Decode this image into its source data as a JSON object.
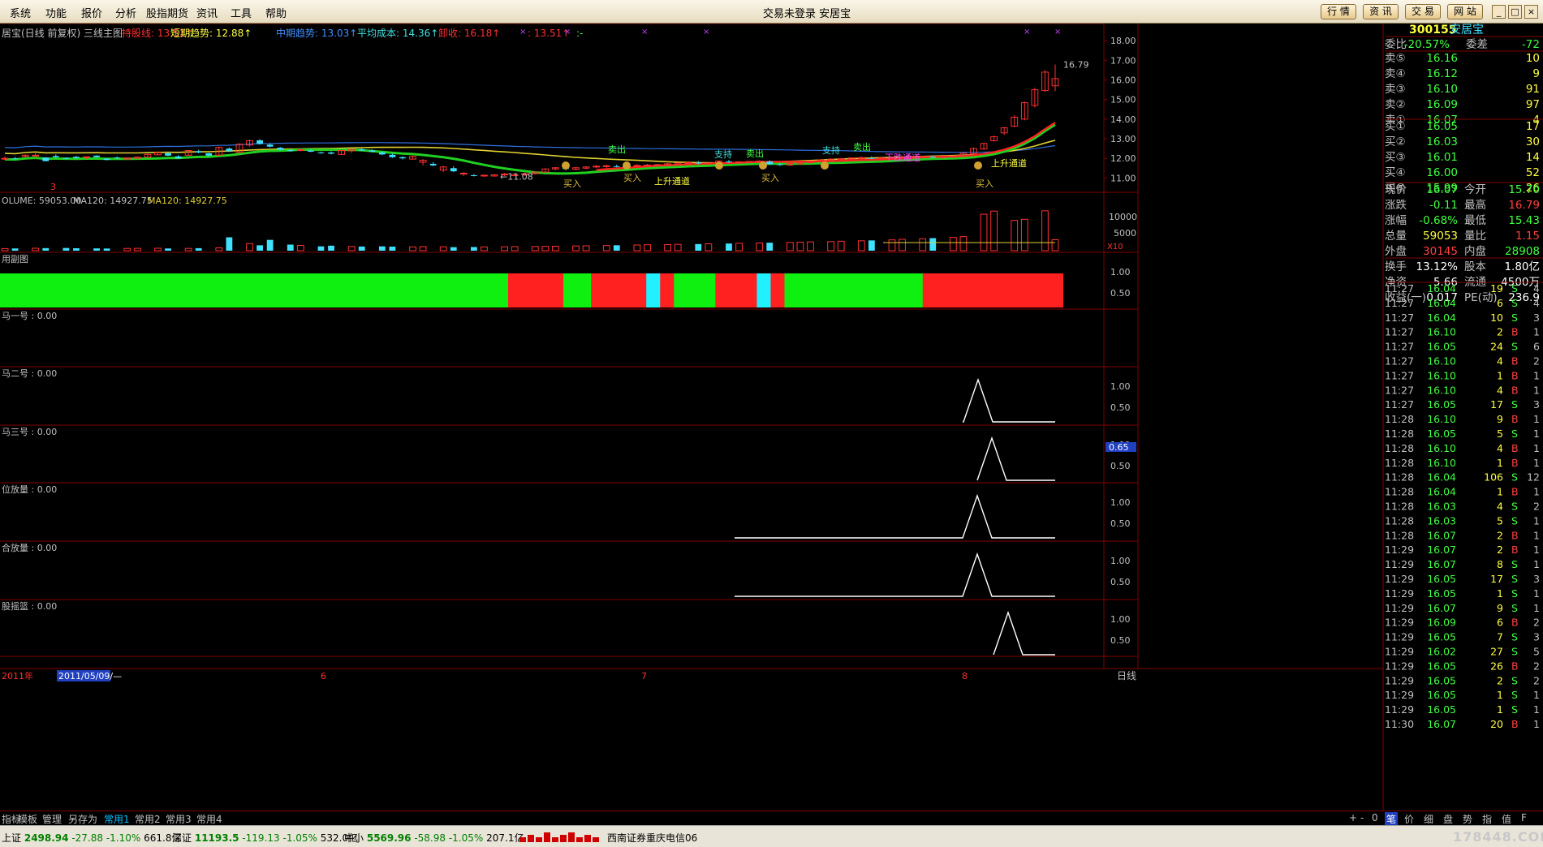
{
  "menu": [
    "系统",
    "功能",
    "报价",
    "分析",
    "股指期货",
    "资讯",
    "工具",
    "帮助"
  ],
  "window": {
    "title": "交易未登录  安居宝"
  },
  "top_buttons": [
    "行 情",
    "资 讯",
    "交 易",
    "网 站"
  ],
  "window_controls": [
    "_",
    "□",
    "×"
  ],
  "main_panel": {
    "title": "居宝(日线 前复权) 三线主图",
    "indicators": [
      {
        "text": "持股线: 13.51↑",
        "color": "#ff3030"
      },
      {
        "text": "短期趋势: 12.88↑",
        "color": "#ffff40"
      },
      {
        "text": "中期趋势: 13.03↑",
        "color": "#4090ff"
      },
      {
        "text": "平均成本: 14.36↑",
        "color": "#40e0e0"
      },
      {
        "text": "卸收: 16.18↑",
        "color": "#ff3030"
      },
      {
        "text": ": 13.51↑",
        "color": "#ff3030"
      },
      {
        "text": ":-",
        "color": "#40ff40"
      }
    ],
    "price_ticks": [
      "18.00",
      "17.00",
      "16.00",
      "15.00",
      "14.00",
      "13.00",
      "12.00",
      "11.00"
    ],
    "high_label": "16.79",
    "low_label": "←11.08",
    "annotations": [
      {
        "text": "卖出",
        "x": 760,
        "y": 176,
        "color": "#40ff40"
      },
      {
        "text": "买入",
        "x": 705,
        "y": 218,
        "color": "#e0c040"
      },
      {
        "text": "买入",
        "x": 779,
        "y": 211,
        "color": "#e0c040"
      },
      {
        "text": "上升通道",
        "x": 828,
        "y": 215,
        "color": "#ffff40"
      },
      {
        "text": "支持",
        "x": 891,
        "y": 182,
        "color": "#40e0e0"
      },
      {
        "text": "卖出",
        "x": 930,
        "y": 181,
        "color": "#40ff40"
      },
      {
        "text": "买入",
        "x": 949,
        "y": 211,
        "color": "#e0c040"
      },
      {
        "text": "支持",
        "x": 1024,
        "y": 177,
        "color": "#40e0e0"
      },
      {
        "text": "卖出",
        "x": 1062,
        "y": 173,
        "color": "#40ff40"
      },
      {
        "text": "下跌通道",
        "x": 1112,
        "y": 186,
        "color": "#ff40ff"
      },
      {
        "text": "上升通道",
        "x": 1243,
        "y": 193,
        "color": "#ffff40"
      },
      {
        "text": "买入",
        "x": 1213,
        "y": 218,
        "color": "#e0c040"
      }
    ],
    "marker_3": "3"
  },
  "volume_panel": {
    "title": "OLUME: 59053.00",
    "ma1": "MA120: 14927.75",
    "ma2": "MA120: 14927.75",
    "ticks": [
      "10000",
      "5000"
    ],
    "scale": "X10"
  },
  "sub_panels": [
    {
      "name": "用副图",
      "ticks": [
        "1.00",
        "0.50"
      ]
    },
    {
      "name": "马一号 : 0.00",
      "ticks": []
    },
    {
      "name": "马二号 : 0.00",
      "ticks": [
        "1.00",
        "0.50"
      ]
    },
    {
      "name": "马三号 : 0.00",
      "ticks": [
        "1.00",
        "0.50"
      ],
      "badge": "0.65"
    },
    {
      "name": "位放量 : 0.00",
      "ticks": [
        "1.00",
        "0.50"
      ]
    },
    {
      "name": "合放量 : 0.00",
      "ticks": [
        "1.00",
        "0.50"
      ]
    },
    {
      "name": "股摇篮 : 0.00",
      "ticks": [
        "1.00",
        "0.50"
      ]
    }
  ],
  "time_axis": {
    "labels": [
      "2011年",
      "6",
      "7",
      "8"
    ],
    "selected_date": "2011/05/09/—",
    "period": "日线"
  },
  "quote": {
    "code": "300155",
    "name": "安居宝",
    "weibi_label": "委比",
    "weibi": "-20.57%",
    "weicha_label": "委差",
    "weicha": "-72",
    "sell": [
      {
        "label": "卖⑤",
        "price": "16.16",
        "vol": "10"
      },
      {
        "label": "卖④",
        "price": "16.12",
        "vol": "9"
      },
      {
        "label": "卖③",
        "price": "16.10",
        "vol": "91"
      },
      {
        "label": "卖②",
        "price": "16.09",
        "vol": "97"
      },
      {
        "label": "卖①",
        "price": "16.07",
        "vol": "4"
      }
    ],
    "buy": [
      {
        "label": "买①",
        "price": "16.05",
        "vol": "17"
      },
      {
        "label": "买②",
        "price": "16.03",
        "vol": "30"
      },
      {
        "label": "买③",
        "price": "16.01",
        "vol": "14"
      },
      {
        "label": "买④",
        "price": "16.00",
        "vol": "52"
      },
      {
        "label": "买⑤",
        "price": "15.99",
        "vol": "26"
      }
    ],
    "stats": [
      {
        "l1": "现价",
        "v1": "16.07",
        "c1": "#40ff40",
        "l2": "今开",
        "v2": "15.70",
        "c2": "#40ff40"
      },
      {
        "l1": "涨跌",
        "v1": "-0.11",
        "c1": "#40ff40",
        "l2": "最高",
        "v2": "16.79",
        "c2": "#ff4040"
      },
      {
        "l1": "涨幅",
        "v1": "-0.68%",
        "c1": "#40ff40",
        "l2": "最低",
        "v2": "15.43",
        "c2": "#40ff40"
      },
      {
        "l1": "总量",
        "v1": "59053",
        "c1": "#ffff40",
        "l2": "量比",
        "v2": "1.15",
        "c2": "#ff4040"
      },
      {
        "l1": "外盘",
        "v1": "30145",
        "c1": "#ff4040",
        "l2": "内盘",
        "v2": "28908",
        "c2": "#40ff40"
      },
      {
        "l1": "换手",
        "v1": "13.12%",
        "c1": "#ffffff",
        "l2": "股本",
        "v2": "1.80亿",
        "c2": "#ffffff"
      },
      {
        "l1": "净资",
        "v1": "5.66",
        "c1": "#ffffff",
        "l2": "流通",
        "v2": "4500万",
        "c2": "#ffffff"
      },
      {
        "l1": "收益(一)",
        "v1": "0.017",
        "c1": "#ffffff",
        "l2": "PE(动)",
        "v2": "236.9",
        "c2": "#ffffff"
      }
    ],
    "ticks": [
      [
        "11:27",
        "16.04",
        "19",
        "S",
        "4"
      ],
      [
        "11:27",
        "16.04",
        "6",
        "S",
        "4"
      ],
      [
        "11:27",
        "16.04",
        "10",
        "S",
        "3"
      ],
      [
        "11:27",
        "16.10",
        "2",
        "B",
        "1"
      ],
      [
        "11:27",
        "16.05",
        "24",
        "S",
        "6"
      ],
      [
        "11:27",
        "16.10",
        "4",
        "B",
        "2"
      ],
      [
        "11:27",
        "16.10",
        "1",
        "B",
        "1"
      ],
      [
        "11:27",
        "16.10",
        "4",
        "B",
        "1"
      ],
      [
        "11:27",
        "16.05",
        "17",
        "S",
        "3"
      ],
      [
        "11:28",
        "16.10",
        "9",
        "B",
        "1"
      ],
      [
        "11:28",
        "16.05",
        "5",
        "S",
        "1"
      ],
      [
        "11:28",
        "16.10",
        "4",
        "B",
        "1"
      ],
      [
        "11:28",
        "16.10",
        "1",
        "B",
        "1"
      ],
      [
        "11:28",
        "16.04",
        "106",
        "S",
        "12"
      ],
      [
        "11:28",
        "16.04",
        "1",
        "B",
        "1"
      ],
      [
        "11:28",
        "16.03",
        "4",
        "S",
        "2"
      ],
      [
        "11:28",
        "16.03",
        "5",
        "S",
        "1"
      ],
      [
        "11:28",
        "16.07",
        "2",
        "B",
        "1"
      ],
      [
        "11:29",
        "16.07",
        "2",
        "B",
        "1"
      ],
      [
        "11:29",
        "16.07",
        "8",
        "S",
        "1"
      ],
      [
        "11:29",
        "16.05",
        "17",
        "S",
        "3"
      ],
      [
        "11:29",
        "16.05",
        "1",
        "S",
        "1"
      ],
      [
        "11:29",
        "16.07",
        "9",
        "S",
        "1"
      ],
      [
        "11:29",
        "16.09",
        "6",
        "B",
        "2"
      ],
      [
        "11:29",
        "16.05",
        "7",
        "S",
        "3"
      ],
      [
        "11:29",
        "16.02",
        "27",
        "S",
        "5"
      ],
      [
        "11:29",
        "16.05",
        "26",
        "B",
        "2"
      ],
      [
        "11:29",
        "16.05",
        "2",
        "S",
        "2"
      ],
      [
        "11:29",
        "16.05",
        "1",
        "S",
        "1"
      ],
      [
        "11:29",
        "16.05",
        "1",
        "S",
        "1"
      ],
      [
        "11:30",
        "16.07",
        "20",
        "B",
        "1"
      ]
    ]
  },
  "bottom_tabs": [
    "指标",
    "模板",
    "管理",
    "另存为",
    "常用1",
    "常用2",
    "常用3",
    "常用4"
  ],
  "active_bottom_tab": "常用1",
  "nav_buttons": [
    "+",
    "-",
    "0"
  ],
  "right_tabs": [
    "笔",
    "价",
    "细",
    "盘",
    "势",
    "指",
    "值",
    "F"
  ],
  "status": {
    "sh_label": "上证",
    "sh_val": "2498.94",
    "sh_chg": "-27.88",
    "sh_pct": "-1.10%",
    "sh_amt": "661.8亿",
    "sz_label": "深证",
    "sz_val": "11193.5",
    "sz_chg": "-119.13",
    "sz_pct": "-1.05%",
    "sz_amt": "532.0亿",
    "zx_label": "中小",
    "zx_val": "5569.96",
    "zx_chg": "-58.98",
    "zx_pct": "-1.05%",
    "zx_amt": "207.1亿",
    "broker": "西南证券重庆电信06"
  },
  "watermark": "178448.COM",
  "chart_data": {
    "type": "candlestick",
    "ylim": [
      10.6,
      18.3
    ],
    "candles": [
      [
        11.96,
        12.1,
        11.92,
        12.0
      ],
      [
        12.0,
        12.08,
        11.95,
        11.98
      ],
      [
        12.1,
        12.2,
        12.04,
        12.16
      ],
      [
        12.14,
        12.32,
        11.98,
        12.16
      ],
      [
        12.04,
        12.06,
        11.85,
        11.86
      ],
      [
        12.12,
        12.2,
        12.02,
        12.06
      ],
      [
        12.02,
        12.05,
        11.96,
        12.0
      ],
      [
        12.08,
        12.12,
        11.98,
        12.02
      ],
      [
        12.06,
        12.1,
        11.98,
        12.08
      ],
      [
        12.14,
        12.16,
        12.05,
        12.06
      ],
      [
        11.98,
        12.0,
        11.9,
        11.92
      ],
      [
        12.04,
        12.1,
        11.96,
        12.0
      ],
      [
        11.96,
        12.05,
        11.94,
        12.02
      ],
      [
        12.0,
        12.1,
        11.96,
        12.06
      ],
      [
        12.06,
        12.24,
        12.04,
        12.2
      ],
      [
        12.18,
        12.36,
        12.16,
        12.3
      ],
      [
        12.26,
        12.3,
        12.12,
        12.14
      ],
      [
        12.1,
        12.16,
        11.98,
        12.0
      ],
      [
        12.16,
        12.42,
        12.14,
        12.4
      ],
      [
        12.36,
        12.44,
        12.26,
        12.3
      ],
      [
        12.26,
        12.28,
        12.1,
        12.14
      ],
      [
        12.16,
        12.6,
        12.14,
        12.56
      ],
      [
        12.5,
        12.56,
        12.32,
        12.36
      ],
      [
        12.3,
        12.78,
        12.28,
        12.72
      ],
      [
        12.68,
        12.96,
        12.6,
        12.9
      ],
      [
        12.92,
        12.98,
        12.7,
        12.74
      ],
      [
        12.7,
        12.76,
        12.56,
        12.6
      ],
      [
        12.54,
        12.58,
        12.4,
        12.44
      ],
      [
        12.42,
        12.46,
        12.34,
        12.38
      ],
      [
        12.4,
        12.48,
        12.36,
        12.44
      ],
      [
        12.4,
        12.46,
        12.32,
        12.34
      ],
      [
        12.3,
        12.34,
        12.24,
        12.26
      ],
      [
        12.3,
        12.36,
        12.2,
        12.24
      ],
      [
        12.2,
        12.46,
        12.18,
        12.4
      ],
      [
        12.38,
        12.5,
        12.3,
        12.46
      ],
      [
        12.46,
        12.52,
        12.36,
        12.4
      ],
      [
        12.4,
        12.46,
        12.3,
        12.34
      ],
      [
        12.3,
        12.36,
        12.16,
        12.2
      ],
      [
        12.18,
        12.24,
        12.02,
        12.06
      ],
      [
        12.06,
        12.1,
        11.94,
        12.0
      ],
      [
        11.96,
        12.14,
        11.94,
        12.1
      ],
      [
        11.8,
        11.96,
        11.64,
        11.9
      ],
      [
        11.72,
        11.8,
        11.6,
        11.64
      ],
      [
        11.4,
        11.62,
        11.3,
        11.56
      ],
      [
        11.5,
        11.6,
        11.3,
        11.34
      ],
      [
        11.2,
        11.3,
        11.1,
        11.24
      ],
      [
        11.14,
        11.2,
        11.08,
        11.1
      ],
      [
        11.1,
        11.16,
        11.05,
        11.14
      ],
      [
        11.1,
        11.2,
        11.06,
        11.16
      ],
      [
        11.16,
        11.26,
        11.1,
        11.2
      ],
      [
        11.12,
        11.22,
        11.08,
        11.18
      ],
      [
        11.16,
        11.26,
        11.1,
        11.22
      ],
      [
        11.22,
        11.34,
        11.18,
        11.3
      ],
      [
        11.3,
        11.5,
        11.26,
        11.46
      ],
      [
        11.46,
        11.56,
        11.4,
        11.52
      ],
      [
        11.5,
        11.58,
        11.4,
        11.46
      ],
      [
        11.44,
        11.56,
        11.4,
        11.52
      ],
      [
        11.5,
        11.6,
        11.44,
        11.56
      ],
      [
        11.56,
        11.66,
        11.5,
        11.6
      ],
      [
        11.58,
        11.68,
        11.52,
        11.62
      ],
      [
        11.6,
        11.68,
        11.54,
        11.58
      ],
      [
        11.56,
        11.64,
        11.5,
        11.6
      ],
      [
        11.6,
        11.7,
        11.56,
        11.64
      ],
      [
        11.62,
        11.72,
        11.56,
        11.66
      ],
      [
        11.64,
        11.72,
        11.58,
        11.68
      ],
      [
        11.66,
        11.76,
        11.62,
        11.72
      ],
      [
        11.7,
        11.8,
        11.66,
        11.76
      ],
      [
        11.74,
        11.84,
        11.68,
        11.78
      ],
      [
        11.78,
        11.86,
        11.7,
        11.74
      ],
      [
        11.72,
        11.8,
        11.66,
        11.76
      ],
      [
        11.74,
        11.9,
        11.7,
        11.86
      ],
      [
        11.84,
        11.92,
        11.76,
        11.8
      ],
      [
        11.78,
        11.86,
        11.72,
        11.82
      ],
      [
        11.8,
        11.86,
        11.76,
        11.84
      ],
      [
        11.82,
        11.9,
        11.78,
        11.86
      ],
      [
        11.84,
        11.9,
        11.66,
        11.7
      ],
      [
        11.7,
        11.76,
        11.62,
        11.66
      ],
      [
        11.66,
        11.78,
        11.6,
        11.74
      ],
      [
        11.72,
        11.82,
        11.68,
        11.78
      ],
      [
        11.78,
        11.9,
        11.74,
        11.86
      ],
      [
        11.86,
        11.96,
        11.8,
        11.92
      ],
      [
        11.9,
        12.0,
        11.86,
        11.96
      ],
      [
        11.94,
        12.02,
        11.88,
        11.98
      ],
      [
        11.96,
        12.06,
        11.92,
        12.02
      ],
      [
        12.0,
        12.1,
        11.94,
        12.04
      ],
      [
        12.02,
        12.1,
        11.96,
        12.0
      ],
      [
        11.98,
        12.06,
        11.94,
        12.02
      ],
      [
        12.0,
        12.08,
        11.96,
        12.04
      ],
      [
        12.02,
        12.1,
        11.98,
        12.06
      ],
      [
        12.04,
        12.12,
        12.0,
        12.08
      ],
      [
        12.06,
        12.14,
        12.02,
        12.1
      ],
      [
        12.08,
        12.14,
        12.02,
        12.06
      ],
      [
        12.04,
        12.12,
        11.98,
        12.08
      ],
      [
        12.06,
        12.14,
        12.02,
        12.1
      ],
      [
        12.1,
        12.3,
        12.06,
        12.26
      ],
      [
        12.24,
        12.56,
        12.2,
        12.5
      ],
      [
        12.48,
        12.8,
        12.44,
        12.76
      ],
      [
        12.9,
        13.16,
        12.86,
        13.1
      ],
      [
        13.3,
        13.6,
        13.2,
        13.56
      ],
      [
        13.64,
        14.2,
        13.6,
        14.1
      ],
      [
        14.0,
        14.9,
        13.94,
        14.84
      ],
      [
        14.7,
        15.6,
        14.6,
        15.5
      ],
      [
        15.46,
        16.5,
        15.4,
        16.4
      ],
      [
        15.7,
        16.79,
        15.43,
        16.07
      ]
    ],
    "volume": [
      310,
      330,
      360,
      380,
      400,
      360,
      340,
      320,
      330,
      350,
      360,
      330,
      340,
      370,
      420,
      1980,
      1060,
      800,
      1600,
      900,
      780,
      640,
      740,
      620,
      620,
      640,
      600,
      560,
      600,
      580,
      520,
      540,
      560,
      580,
      600,
      620,
      640,
      660,
      700,
      720,
      760,
      800,
      840,
      880,
      900,
      940,
      980,
      1020,
      1060,
      1100,
      1140,
      1180,
      1220,
      1260,
      1300,
      1340,
      1400,
      1460,
      1520,
      1600,
      1680,
      1760,
      1860,
      1960,
      2080,
      5400,
      5860,
      4480,
      4640,
      5900,
      1620
    ],
    "sub_colors": [
      "g",
      "g",
      "g",
      "g",
      "g",
      "g",
      "g",
      "g",
      "g",
      "g",
      "g",
      "g",
      "g",
      "g",
      "g",
      "g",
      "g",
      "g",
      "g",
      "g",
      "g",
      "g",
      "g",
      "g",
      "g",
      "g",
      "g",
      "g",
      "g",
      "g",
      "g",
      "g",
      "g",
      "g",
      "g",
      "g",
      "g",
      "r",
      "r",
      "r",
      "r",
      "g",
      "g",
      "r",
      "r",
      "r",
      "r",
      "c",
      "r",
      "g",
      "g",
      "g",
      "r",
      "r",
      "r",
      "c",
      "r",
      "g",
      "g",
      "g",
      "g",
      "g",
      "g",
      "g",
      "g",
      "g",
      "g",
      "r",
      "r",
      "r",
      "r",
      "r",
      "r",
      "r",
      "r",
      "r",
      "r"
    ]
  }
}
